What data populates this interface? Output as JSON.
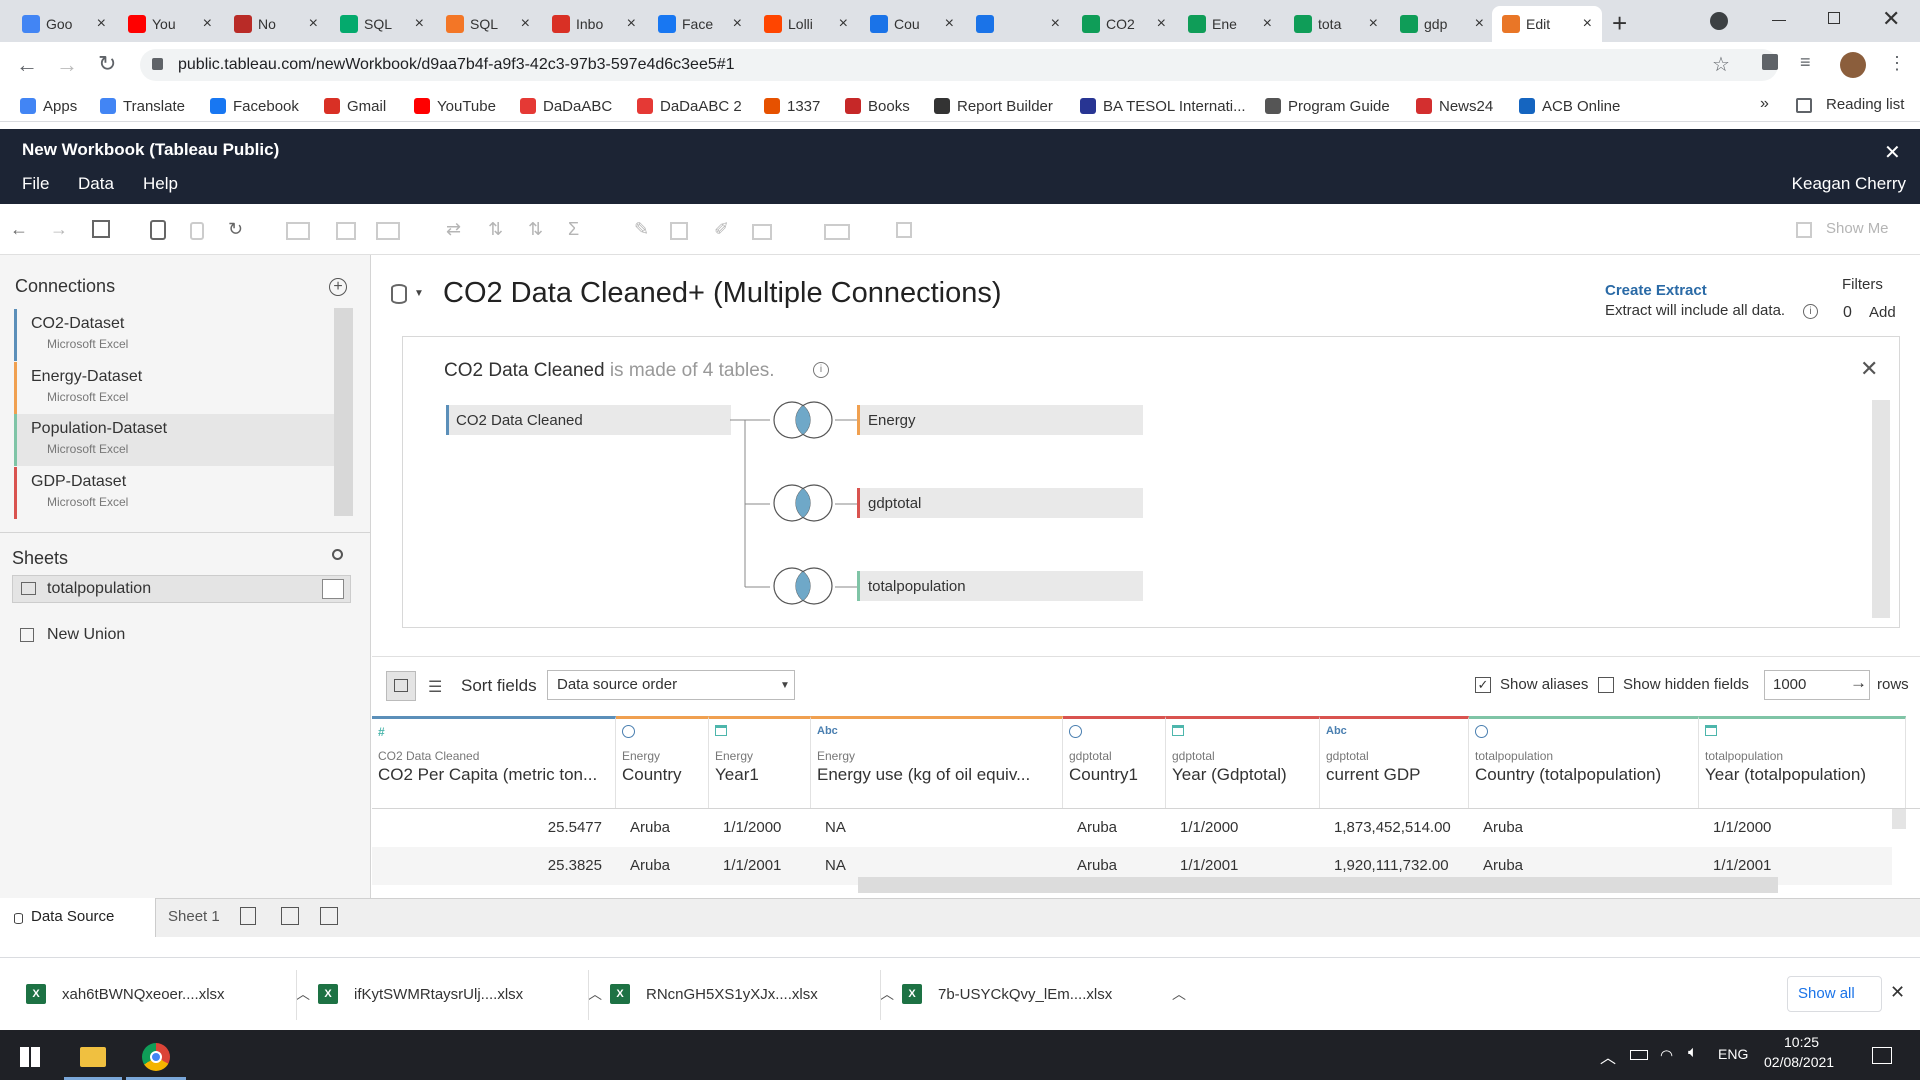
{
  "browser": {
    "tabs": [
      {
        "label": "Goo",
        "icon": "google-icon",
        "color": "#4285f4"
      },
      {
        "label": "You",
        "icon": "youtube-icon",
        "color": "#ff0000"
      },
      {
        "label": "No",
        "icon": "quora-icon",
        "color": "#b92b27"
      },
      {
        "label": "SQL",
        "icon": "w3schools-icon",
        "color": "#04aa6d"
      },
      {
        "label": "SQL",
        "icon": "sql-icon",
        "color": "#f37626"
      },
      {
        "label": "Inbo",
        "icon": "gmail-icon",
        "color": "#d93025"
      },
      {
        "label": "Face",
        "icon": "facebook-icon",
        "color": "#1877f2"
      },
      {
        "label": "Lolli",
        "icon": "reddit-icon",
        "color": "#ff4500"
      },
      {
        "label": "Cou",
        "icon": "chrome-c-icon",
        "color": "#1a73e8"
      },
      {
        "label": "",
        "icon": "chrome-c-audio-icon",
        "color": "#1a73e8"
      },
      {
        "label": "CO2",
        "icon": "sheets-icon",
        "color": "#0f9d58"
      },
      {
        "label": "Ene",
        "icon": "sheets-icon",
        "color": "#0f9d58"
      },
      {
        "label": "tota",
        "icon": "sheets-icon",
        "color": "#0f9d58"
      },
      {
        "label": "gdp",
        "icon": "sheets-icon",
        "color": "#0f9d58"
      },
      {
        "label": "Edit",
        "icon": "tableau-icon",
        "color": "#e97627"
      }
    ],
    "url": "public.tableau.com/newWorkbook/d9aa7b4f-a9f3-42c3-97b3-597e4d6c3ee5#1",
    "bookmarks": [
      {
        "label": "Apps",
        "color": "#4285f4"
      },
      {
        "label": "Translate",
        "color": "#4285f4"
      },
      {
        "label": "Facebook",
        "color": "#1877f2"
      },
      {
        "label": "Gmail",
        "color": "#d93025"
      },
      {
        "label": "YouTube",
        "color": "#ff0000"
      },
      {
        "label": "DaDaABC",
        "color": "#e53935"
      },
      {
        "label": "DaDaABC 2",
        "color": "#e53935"
      },
      {
        "label": "1337",
        "color": "#e65100"
      },
      {
        "label": "Books",
        "color": "#c62828"
      },
      {
        "label": "Report Builder",
        "color": "#333333"
      },
      {
        "label": "BA TESOL Internati...",
        "color": "#283593"
      },
      {
        "label": "Program Guide",
        "color": "#555555"
      },
      {
        "label": "News24",
        "color": "#d32f2f"
      },
      {
        "label": "ACB Online",
        "color": "#1565c0"
      }
    ],
    "more": "»",
    "reading_list": "Reading list"
  },
  "app": {
    "title": "New Workbook (Tableau Public)",
    "menu": [
      "File",
      "Data",
      "Help"
    ],
    "user": "Keagan Cherry",
    "show_me": "Show Me"
  },
  "left": {
    "connections_title": "Connections",
    "connections": [
      {
        "name": "CO2-Dataset",
        "sub": "Microsoft Excel",
        "color": "#5b8fb9"
      },
      {
        "name": "Energy-Dataset",
        "sub": "Microsoft Excel",
        "color": "#f0a050"
      },
      {
        "name": "Population-Dataset",
        "sub": "Microsoft Excel",
        "color": "#7fc4a6"
      },
      {
        "name": "GDP-Dataset",
        "sub": "Microsoft Excel",
        "color": "#d9534f"
      }
    ],
    "sheets_title": "Sheets",
    "sheet": "totalpopulation",
    "new_union": "New Union"
  },
  "datasource": {
    "title": "CO2 Data Cleaned+ (Multiple Connections)",
    "create_extract": "Create Extract",
    "extract_note": "Extract will include all data.",
    "filters_label": "Filters",
    "filters_count": "0",
    "filters_add": "Add",
    "summary_name": "CO2 Data Cleaned",
    "summary_rest": "is made of 4 tables.",
    "base_table": "CO2 Data Cleaned",
    "joined": [
      {
        "name": "Energy",
        "color": "#f0a050"
      },
      {
        "name": "gdptotal",
        "color": "#d9534f"
      },
      {
        "name": "totalpopulation",
        "color": "#7fc4a6"
      }
    ]
  },
  "grid": {
    "sort_label": "Sort fields",
    "sort_value": "Data source order",
    "show_aliases": "Show aliases",
    "show_hidden": "Show hidden fields",
    "rows_value": "1000",
    "rows_label": "rows",
    "columns": [
      {
        "type": "#",
        "type_color": "#4db6ac",
        "source": "CO2 Data Cleaned",
        "name": "CO2 Per Capita (metric ton...",
        "bar": "#5b8fb9"
      },
      {
        "type": "globe",
        "type_color": "#4a7fb0",
        "source": "Energy",
        "name": "Country",
        "bar": "#f0a050"
      },
      {
        "type": "date",
        "type_color": "#4db6ac",
        "source": "Energy",
        "name": "Year1",
        "bar": "#f0a050"
      },
      {
        "type": "Abc",
        "type_color": "#4a7fb0",
        "source": "Energy",
        "name": "Energy use (kg of oil equiv...",
        "bar": "#f0a050"
      },
      {
        "type": "globe",
        "type_color": "#4a7fb0",
        "source": "gdptotal",
        "name": "Country1",
        "bar": "#d9534f"
      },
      {
        "type": "date",
        "type_color": "#4db6ac",
        "source": "gdptotal",
        "name": "Year (Gdptotal)",
        "bar": "#d9534f"
      },
      {
        "type": "Abc",
        "type_color": "#4a7fb0",
        "source": "gdptotal",
        "name": "current GDP",
        "bar": "#d9534f"
      },
      {
        "type": "globe",
        "type_color": "#4a7fb0",
        "source": "totalpopulation",
        "name": "Country (totalpopulation)",
        "bar": "#7fc4a6"
      },
      {
        "type": "date",
        "type_color": "#4db6ac",
        "source": "totalpopulation",
        "name": "Year (totalpopulation)",
        "bar": "#7fc4a6"
      }
    ],
    "rows": [
      [
        "25.5477",
        "Aruba",
        "1/1/2000",
        "NA",
        "Aruba",
        "1/1/2000",
        "1,873,452,514.00",
        "Aruba",
        "1/1/2000"
      ],
      [
        "25.3825",
        "Aruba",
        "1/1/2001",
        "NA",
        "Aruba",
        "1/1/2001",
        "1,920,111,732.00",
        "Aruba",
        "1/1/2001"
      ]
    ]
  },
  "bottom_tabs": {
    "data_source": "Data Source",
    "sheet1": "Sheet 1"
  },
  "downloads": {
    "files": [
      "xah6tBWNQxeoer....xlsx",
      "ifKytSWMRtaysrUlj....xlsx",
      "RNcnGH5XS1yXJx....xlsx",
      "7b-USYCkQvy_lEm....xlsx"
    ],
    "show_all": "Show all"
  },
  "taskbar": {
    "lang": "ENG",
    "time": "10:25",
    "date": "02/08/2021"
  }
}
